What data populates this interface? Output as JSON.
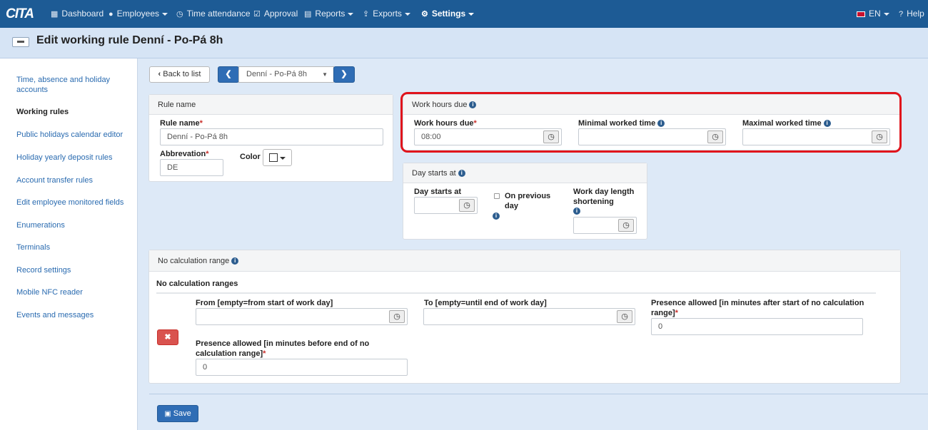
{
  "nav": {
    "logo": "CITA",
    "items": [
      {
        "label": "Dashboard",
        "icon": "grid-icon"
      },
      {
        "label": "Employees",
        "icon": "user-icon"
      },
      {
        "label": "Time attendance",
        "icon": "clock-icon"
      },
      {
        "label": "Approval",
        "icon": "check-icon"
      },
      {
        "label": "Reports",
        "icon": "printer-icon"
      },
      {
        "label": "Exports",
        "icon": "export-icon"
      },
      {
        "label": "Settings",
        "icon": "gear-icon"
      }
    ],
    "language": "EN",
    "help": "Help"
  },
  "page": {
    "title": "Edit working rule Denní - Po-Pá 8h"
  },
  "sidebar": {
    "items": [
      {
        "label": "Time, absence and holiday accounts"
      },
      {
        "label": "Working rules"
      },
      {
        "label": "Public holidays calendar editor"
      },
      {
        "label": "Holiday yearly deposit rules"
      },
      {
        "label": "Account transfer rules"
      },
      {
        "label": "Edit employee monitored fields"
      },
      {
        "label": "Enumerations"
      },
      {
        "label": "Terminals"
      },
      {
        "label": "Record settings"
      },
      {
        "label": "Mobile NFC reader"
      },
      {
        "label": "Events and messages"
      }
    ]
  },
  "toolbar": {
    "back_label": "Back to list",
    "selected_rule": "Denní - Po-Pá 8h"
  },
  "rule_panel": {
    "title": "Rule name",
    "rule_name_label": "Rule name",
    "rule_name_value": "Denní - Po-Pá 8h",
    "abbreviation_label": "Abbrevation",
    "abbreviation_value": "DE",
    "color_label": "Color"
  },
  "work_hours_panel": {
    "title": "Work hours due",
    "due_label": "Work hours due",
    "due_value": "08:00",
    "min_label": "Minimal worked time",
    "min_value": "",
    "max_label": "Maximal worked time",
    "max_value": ""
  },
  "day_panel": {
    "title": "Day starts at",
    "starts_label": "Day starts at",
    "starts_value": "",
    "previous_day_label": "On previous day",
    "shortening_label": "Work day length shortening",
    "shortening_value": ""
  },
  "nocalc_panel": {
    "title": "No calculation range",
    "subtitle": "No calculation ranges",
    "from_label": "From [empty=from start of work day]",
    "from_value": "",
    "to_label": "To [empty=until end of work day]",
    "to_value": "",
    "after_label": "Presence allowed [in minutes after start of no calculation range]",
    "after_value": "0",
    "before_label": "Presence allowed [in minutes before end of no calculation range]",
    "before_value": "0"
  },
  "save_label": "Save",
  "colors": {
    "nav": "#1d5b95",
    "header": "#d6e4f5",
    "main": "#dde9f7",
    "accent": "#2f6db5",
    "highlight": "#e0141c",
    "danger": "#d9534f"
  }
}
